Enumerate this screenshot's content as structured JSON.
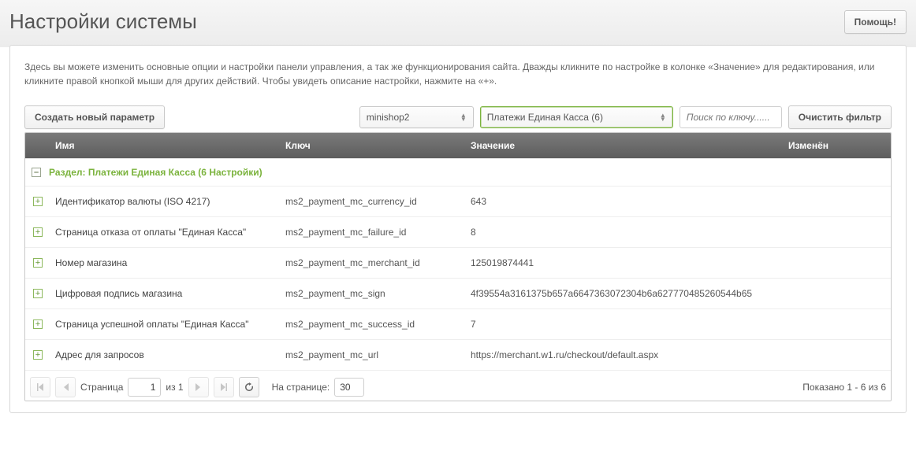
{
  "header": {
    "title": "Настройки системы",
    "help_label": "Помощь!"
  },
  "description": "Здесь вы можете изменить основные опции и настройки панели управления, а так же функционирования сайта. Дважды кликните по настройке в колонке «Значение» для редактирования, или кликните правой кнопкой мыши для других действий. Чтобы увидеть описание настройки, нажмите на «+».",
  "toolbar": {
    "create_label": "Создать новый параметр",
    "namespace": "minishop2",
    "area": "Платежи Единая Касса (6)",
    "search_placeholder": "Поиск по ключу......",
    "clear_filter_label": "Очистить фильтр"
  },
  "columns": {
    "name": "Имя",
    "key": "Ключ",
    "value": "Значение",
    "modified": "Изменён"
  },
  "group": {
    "label": "Раздел: Платежи Единая Касса (6 Настройки)"
  },
  "rows": [
    {
      "name": "Идентификатор валюты (ISO 4217)",
      "key": "ms2_payment_mc_currency_id",
      "value": "643"
    },
    {
      "name": "Страница отказа от оплаты \"Единая Касса\"",
      "key": "ms2_payment_mc_failure_id",
      "value": "8"
    },
    {
      "name": "Номер магазина",
      "key": "ms2_payment_mc_merchant_id",
      "value": "125019874441"
    },
    {
      "name": "Цифровая подпись магазина",
      "key": "ms2_payment_mc_sign",
      "value": "4f39554a3161375b657a6647363072304b6a627770485260544b65"
    },
    {
      "name": "Страница успешной оплаты \"Единая Касса\"",
      "key": "ms2_payment_mc_success_id",
      "value": "7"
    },
    {
      "name": "Адрес для запросов",
      "key": "ms2_payment_mc_url",
      "value": "https://merchant.w1.ru/checkout/default.aspx"
    }
  ],
  "paging": {
    "page_label": "Страница",
    "page": "1",
    "of_label": "из 1",
    "per_page_label": "На странице:",
    "per_page": "30",
    "status": "Показано 1 - 6 из 6"
  }
}
